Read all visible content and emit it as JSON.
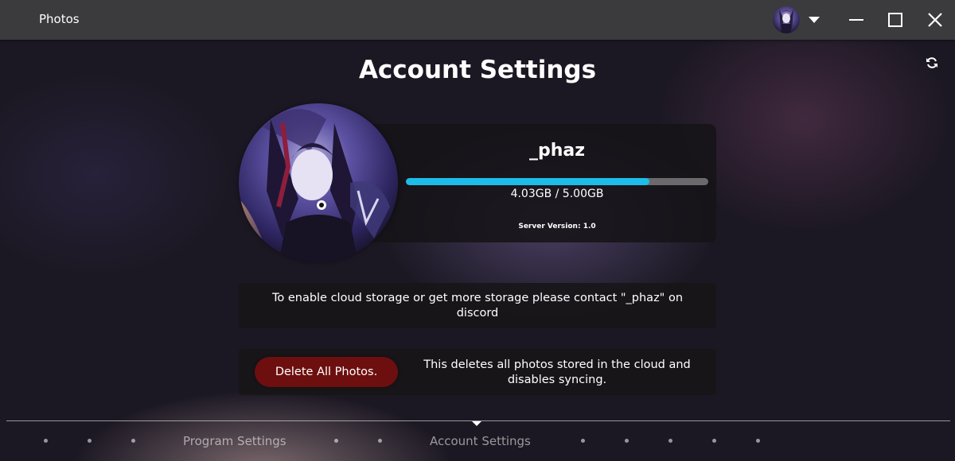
{
  "app": {
    "title": "Photos"
  },
  "titlebar": {
    "avatar": "user-avatar",
    "dropdown_icon": "caret-down-icon",
    "minimize_icon": "minimize-icon",
    "maximize_icon": "maximize-icon",
    "close_icon": "close-icon"
  },
  "page": {
    "title": "Account Settings",
    "refresh_icon": "refresh-icon"
  },
  "profile": {
    "username": "_phaz",
    "storage_used_gb": 4.03,
    "storage_total_gb": 5.0,
    "storage_text": "4.03GB / 5.00GB",
    "server_version": "Server Version: 1.0"
  },
  "info": {
    "text": "To enable cloud storage or get more storage please contact \"_phaz\" on discord"
  },
  "delete": {
    "button_label": "Delete All Photos.",
    "description": "This deletes all photos stored in the cloud and disables syncing."
  },
  "nav": {
    "program_settings": "Program Settings",
    "account_settings": "Account Settings"
  },
  "colors": {
    "accent": "#1cbde9",
    "danger": "#6d0f0f",
    "titlebar": "#3b3b3d"
  }
}
